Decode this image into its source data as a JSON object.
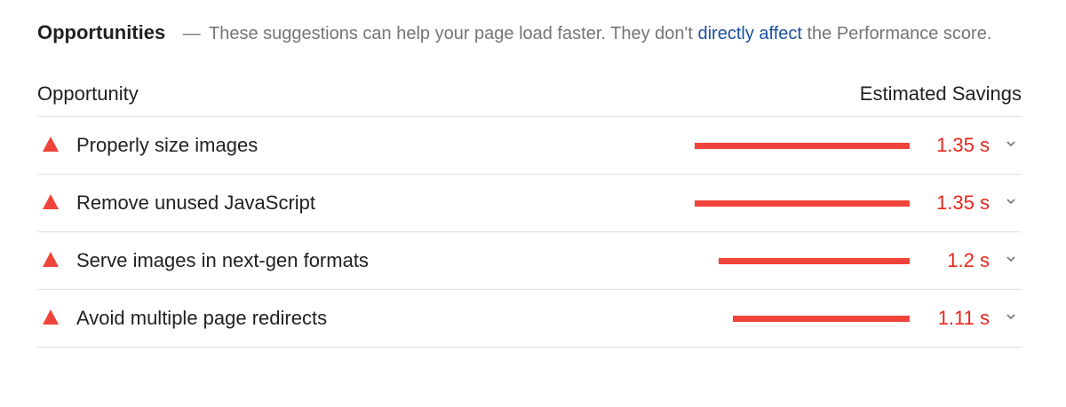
{
  "header": {
    "title": "Opportunities",
    "dash": "—",
    "description_prefix": "These suggestions can help your page load faster. They don't",
    "link_text": "directly affect",
    "description_suffix": "the Performance score."
  },
  "columns": {
    "left": "Opportunity",
    "right": "Estimated Savings"
  },
  "colors": {
    "accent_red": "#f0443a",
    "value_red": "#e8251c",
    "link_blue": "#1a4fa0"
  },
  "rows": [
    {
      "label": "Properly size images",
      "savings": "1.35 s",
      "savings_seconds": 1.35,
      "icon": "warning-triangle-icon"
    },
    {
      "label": "Remove unused JavaScript",
      "savings": "1.35 s",
      "savings_seconds": 1.35,
      "icon": "warning-triangle-icon"
    },
    {
      "label": "Serve images in next-gen formats",
      "savings": "1.2 s",
      "savings_seconds": 1.2,
      "icon": "warning-triangle-icon"
    },
    {
      "label": "Avoid multiple page redirects",
      "savings": "1.11 s",
      "savings_seconds": 1.11,
      "icon": "warning-triangle-icon"
    }
  ]
}
